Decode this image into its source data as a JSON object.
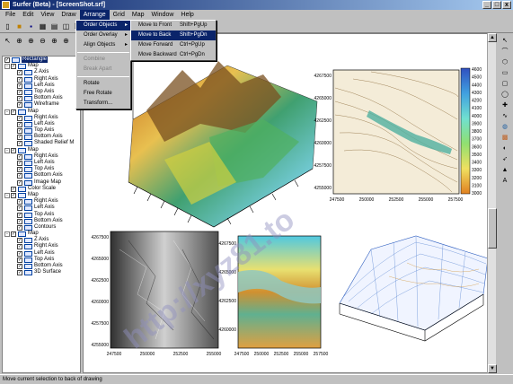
{
  "window": {
    "title": "Surfer (Beta) - [ScreenShot.srf]",
    "min_symbol": "_",
    "max_symbol": "□",
    "close_symbol": "x"
  },
  "menubar": {
    "items": [
      "File",
      "Edit",
      "View",
      "Draw",
      "Arrange",
      "Grid",
      "Map",
      "Window",
      "Help"
    ],
    "active_index": 4
  },
  "arrange_menu": {
    "items": [
      {
        "label": "Order Objects",
        "submenu": true,
        "active": true
      },
      {
        "label": "Order Overlay",
        "submenu": true
      },
      {
        "label": "Align Objects",
        "submenu": true
      },
      {
        "label": "Combine",
        "disabled": true
      },
      {
        "label": "Break Apart",
        "disabled": true
      },
      {
        "label": "Rotate"
      },
      {
        "label": "Free Rotate"
      },
      {
        "label": "Transform..."
      }
    ]
  },
  "order_submenu": {
    "items": [
      {
        "label": "Move to Front",
        "shortcut": "Shift+PgUp"
      },
      {
        "label": "Move to Back",
        "shortcut": "Shift+PgDn",
        "active": true
      },
      {
        "label": "Move Forward",
        "shortcut": "Ctrl+PgUp"
      },
      {
        "label": "Move Backward",
        "shortcut": "Ctrl+PgDn"
      }
    ]
  },
  "tree": {
    "rows": [
      {
        "indent": 0,
        "label": "Rectangle",
        "selected": true,
        "check": true
      },
      {
        "indent": 1,
        "label": "Map",
        "expander": "-",
        "check": true
      },
      {
        "indent": 2,
        "label": "Z Axis",
        "check": true
      },
      {
        "indent": 2,
        "label": "Right Axis",
        "check": true
      },
      {
        "indent": 2,
        "label": "Left Axis",
        "check": true
      },
      {
        "indent": 2,
        "label": "Top Axis",
        "check": true
      },
      {
        "indent": 2,
        "label": "Bottom Axis",
        "check": true
      },
      {
        "indent": 2,
        "label": "Wireframe",
        "check": true
      },
      {
        "indent": 1,
        "label": "Map",
        "expander": "-",
        "check": true
      },
      {
        "indent": 2,
        "label": "Right Axis",
        "check": true
      },
      {
        "indent": 2,
        "label": "Left Axis",
        "check": true
      },
      {
        "indent": 2,
        "label": "Top Axis",
        "check": true
      },
      {
        "indent": 2,
        "label": "Bottom Axis",
        "check": true
      },
      {
        "indent": 2,
        "label": "Shaded Relief M",
        "check": true
      },
      {
        "indent": 1,
        "label": "Map",
        "expander": "-",
        "check": true
      },
      {
        "indent": 2,
        "label": "Right Axis",
        "check": true
      },
      {
        "indent": 2,
        "label": "Left Axis",
        "check": true
      },
      {
        "indent": 2,
        "label": "Top Axis",
        "check": true
      },
      {
        "indent": 2,
        "label": "Bottom Axis",
        "check": true
      },
      {
        "indent": 2,
        "label": "Image Map",
        "check": true
      },
      {
        "indent": 1,
        "label": "Color Scale",
        "check": true
      },
      {
        "indent": 1,
        "label": "Map",
        "expander": "-",
        "check": true
      },
      {
        "indent": 2,
        "label": "Right Axis",
        "check": true
      },
      {
        "indent": 2,
        "label": "Left Axis",
        "check": true
      },
      {
        "indent": 2,
        "label": "Top Axis",
        "check": true
      },
      {
        "indent": 2,
        "label": "Bottom Axis",
        "check": true
      },
      {
        "indent": 2,
        "label": "Contours",
        "check": true
      },
      {
        "indent": 1,
        "label": "Map",
        "expander": "-",
        "check": true
      },
      {
        "indent": 2,
        "label": "Z Axis",
        "check": true
      },
      {
        "indent": 2,
        "label": "Right Axis",
        "check": true
      },
      {
        "indent": 2,
        "label": "Left Axis",
        "check": true
      },
      {
        "indent": 2,
        "label": "Top Axis",
        "check": true
      },
      {
        "indent": 2,
        "label": "Bottom Axis",
        "check": true
      },
      {
        "indent": 2,
        "label": "3D Surface",
        "check": true
      }
    ]
  },
  "maps": {
    "contour_map": {
      "y_ticks": [
        "4267500",
        "4265000",
        "4262500",
        "4260000",
        "4257500",
        "4255000"
      ],
      "x_ticks": [
        "247500",
        "250000",
        "252500",
        "255000",
        "257500"
      ]
    },
    "shaded_relief": {
      "y_ticks": [
        "4267500",
        "4265000",
        "4262500",
        "4260000",
        "4257500",
        "4255000"
      ],
      "x_ticks": [
        "247500",
        "250000",
        "252500",
        "255000"
      ]
    },
    "image_map": {
      "y_ticks": [
        "4267500",
        "4265000",
        "4262500",
        "4260000"
      ],
      "x_ticks": [
        "247500",
        "250000",
        "252500",
        "255000",
        "257500"
      ]
    },
    "color_scale_labels": [
      "4600",
      "4500",
      "4400",
      "4300",
      "4200",
      "4100",
      "4000",
      "3900",
      "3800",
      "3700",
      "3600",
      "3500",
      "3400",
      "3300",
      "3200",
      "3100",
      "3000"
    ]
  },
  "statusbar": {
    "text": "Move current selection to back of drawing"
  },
  "watermark": {
    "text": "http://xyz81.to"
  }
}
